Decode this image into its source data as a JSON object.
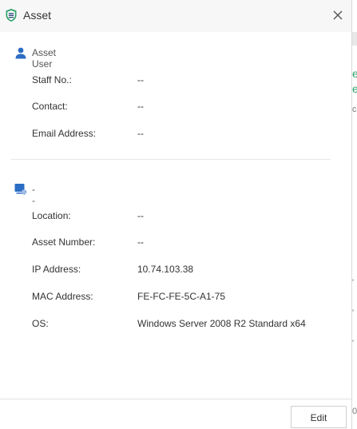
{
  "window": {
    "title": "Asset"
  },
  "colors": {
    "accent": "#2b6cc4",
    "shield": "#2fa36b",
    "divider": "#e6e6e6"
  },
  "user_section": {
    "header_label": "Asset User",
    "icon": "user-icon",
    "fields": [
      {
        "label": "Staff No.:",
        "value": "--"
      },
      {
        "label": "Contact:",
        "value": "--"
      },
      {
        "label": "Email Address:",
        "value": "--"
      }
    ]
  },
  "device_section": {
    "header_label": "--",
    "icon": "computer-settings-icon",
    "fields": [
      {
        "label": "Location:",
        "value": "--"
      },
      {
        "label": "Asset Number:",
        "value": "--"
      },
      {
        "label": "IP Address:",
        "value": "10.74.103.38"
      },
      {
        "label": "MAC Address:",
        "value": "FE-FC-FE-5C-A1-75"
      },
      {
        "label": "OS:",
        "value": "Windows Server 2008 R2 Standard x64"
      }
    ]
  },
  "footer": {
    "edit_label": "Edit"
  },
  "background_fragments": [
    "e",
    "e",
    "c",
    "'",
    "'",
    "'",
    "0"
  ]
}
